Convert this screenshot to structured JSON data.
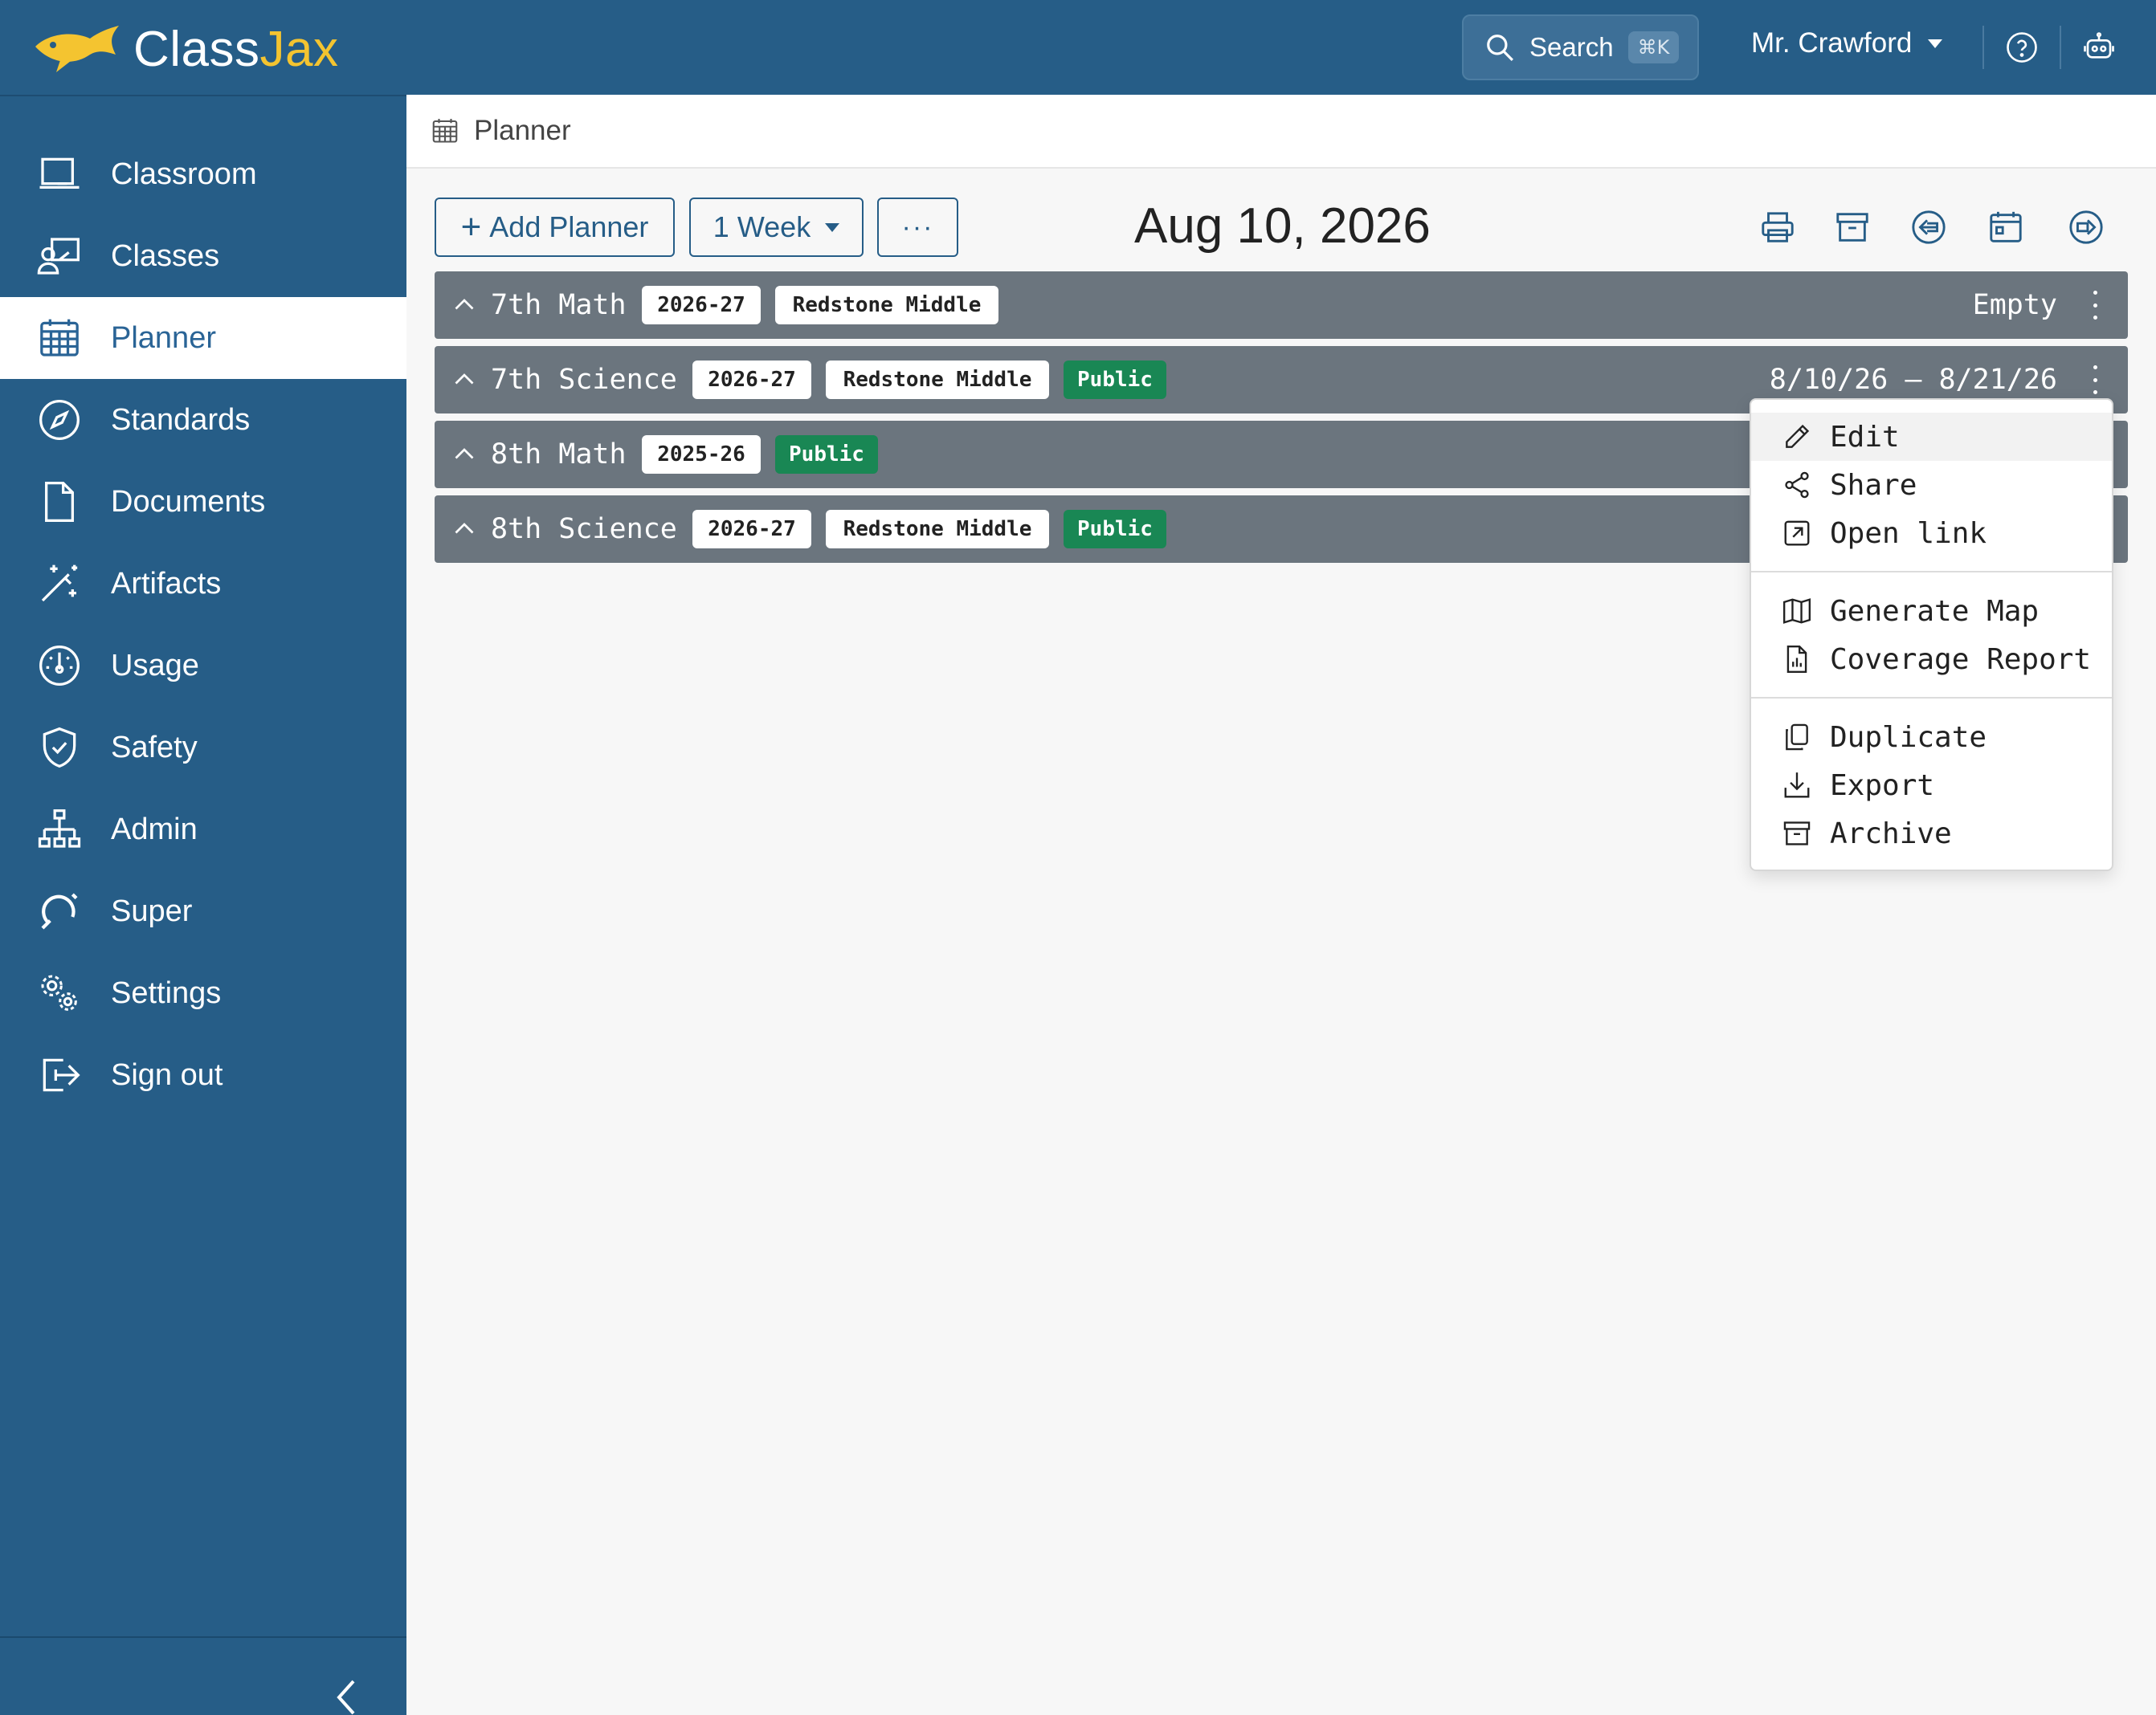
{
  "app": {
    "logo_text_a": "Class",
    "logo_text_b": "Jax",
    "search_label": "Search",
    "search_shortcut": "⌘K",
    "user_name": "Mr. Crawford",
    "icons": [
      "help-icon",
      "robot-icon"
    ]
  },
  "sidebar": {
    "items": [
      {
        "label": "Classroom",
        "icon": "classroom-icon"
      },
      {
        "label": "Classes",
        "icon": "classes-icon"
      },
      {
        "label": "Planner",
        "icon": "calendar-icon",
        "active": true
      },
      {
        "label": "Standards",
        "icon": "compass-icon"
      },
      {
        "label": "Documents",
        "icon": "document-icon"
      },
      {
        "label": "Artifacts",
        "icon": "magic-wand-icon"
      },
      {
        "label": "Usage",
        "icon": "speedometer-icon"
      },
      {
        "label": "Safety",
        "icon": "shield-icon"
      },
      {
        "label": "Admin",
        "icon": "org-chart-icon"
      },
      {
        "label": "Super",
        "icon": "super-icon"
      },
      {
        "label": "Settings",
        "icon": "gears-icon"
      },
      {
        "label": "Sign out",
        "icon": "sign-out-icon"
      }
    ]
  },
  "breadcrumb": {
    "label": "Planner"
  },
  "toolbar": {
    "add_label": "Add Planner",
    "range_label": "1 Week",
    "more_label": "···",
    "date": "Aug 10, 2026",
    "icons": [
      "print-icon",
      "archive-icon",
      "prev-arrow-icon",
      "calendar-today-icon",
      "next-arrow-icon"
    ]
  },
  "planners": [
    {
      "title": "7th Math",
      "year": "2026-27",
      "school": "Redstone Middle",
      "public": "",
      "status": "Empty"
    },
    {
      "title": "7th Science",
      "year": "2026-27",
      "school": "Redstone Middle",
      "public": "Public",
      "status": "8/10/26 – 8/21/26"
    },
    {
      "title": "8th Math",
      "year": "2025-26",
      "school": "",
      "public": "Public",
      "status": ""
    },
    {
      "title": "8th Science",
      "year": "2026-27",
      "school": "Redstone Middle",
      "public": "Public",
      "status": ""
    }
  ],
  "menu": {
    "items": [
      {
        "label": "Edit",
        "icon": "pencil-icon"
      },
      {
        "label": "Share",
        "icon": "share-icon"
      },
      {
        "label": "Open link",
        "icon": "external-link-icon"
      },
      {
        "label": "Generate Map",
        "icon": "map-icon"
      },
      {
        "label": "Coverage Report",
        "icon": "report-icon"
      },
      {
        "label": "Duplicate",
        "icon": "duplicate-icon"
      },
      {
        "label": "Export",
        "icon": "download-icon"
      },
      {
        "label": "Archive",
        "icon": "archive-icon"
      }
    ]
  },
  "colors": {
    "primary": "#265d87",
    "row_bg": "#6b757e",
    "public_badge": "#198754",
    "logo_accent": "#f4c430"
  }
}
